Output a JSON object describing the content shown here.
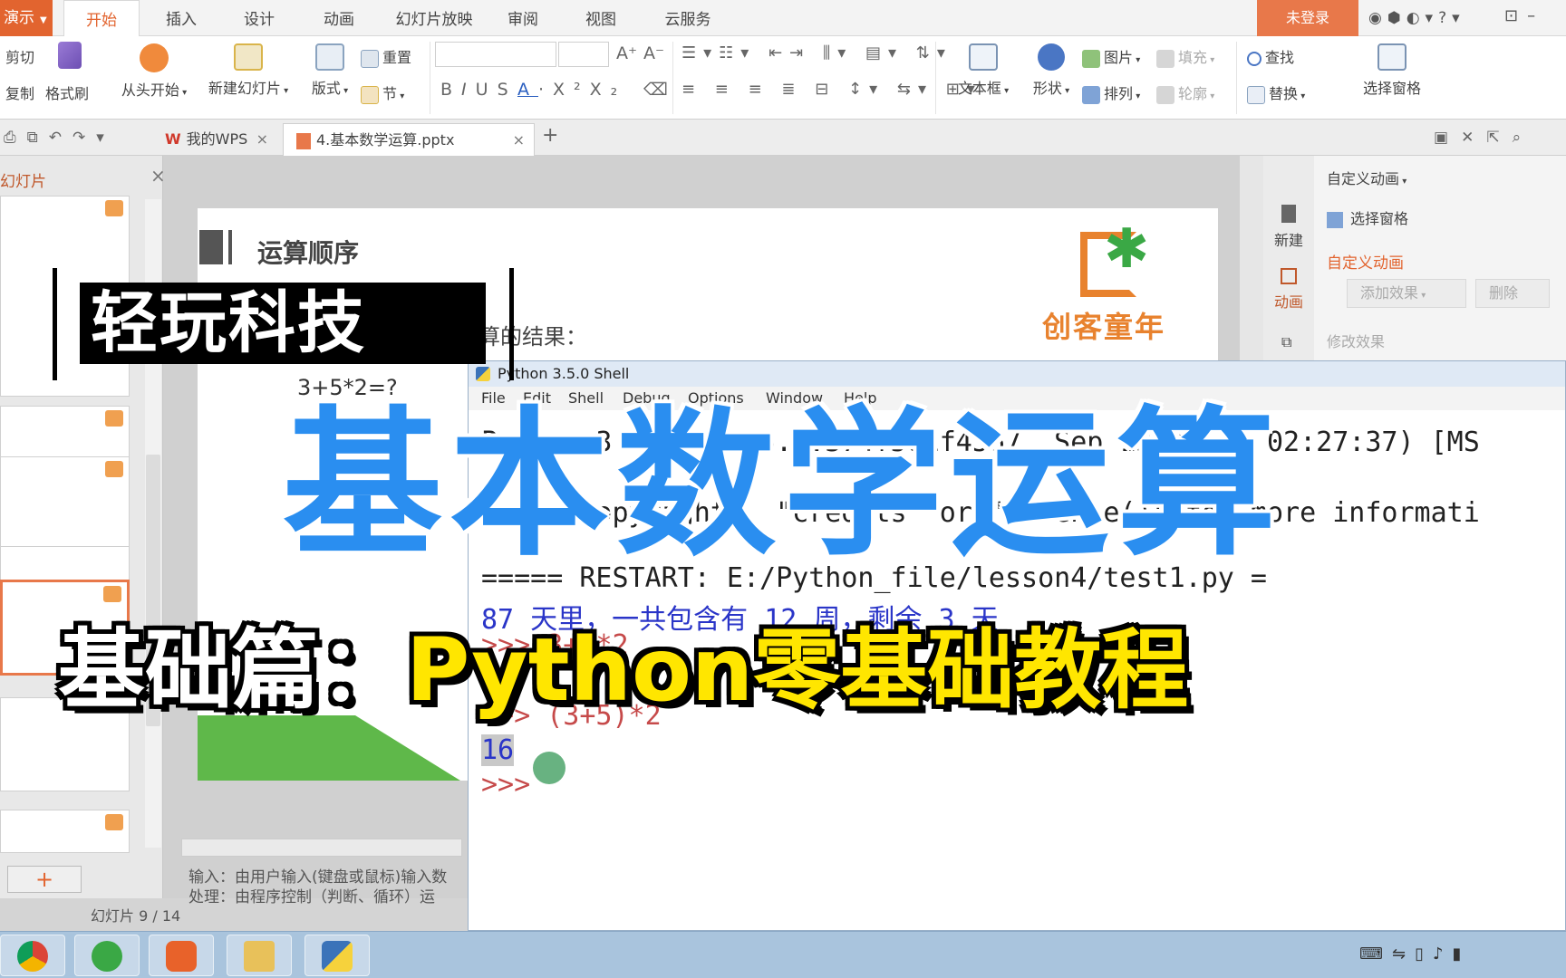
{
  "ribbon_tabs": {
    "app_button": "演示",
    "tabs": [
      "开始",
      "插入",
      "设计",
      "动画",
      "幻灯片放映",
      "审阅",
      "视图",
      "云服务"
    ],
    "active_tab": "开始",
    "login": "未登录"
  },
  "ribbon": {
    "cut": "剪切",
    "copy": "复制",
    "format_painter": "格式刷",
    "from_start": "从头开始",
    "new_slide": "新建幻灯片",
    "layout": "版式",
    "reset": "重置",
    "section": "节",
    "text_box": "文本框",
    "shape": "形状",
    "picture": "图片",
    "arrange": "排列",
    "fill": "填充",
    "outline": "轮廓",
    "find": "查找",
    "replace": "替换",
    "select_pane": "选择窗格"
  },
  "doc_tabs": {
    "my_wps": "我的WPS",
    "file": "4.基本数学运算.pptx",
    "add": "+"
  },
  "left_panel": {
    "title": "幻灯片",
    "status": "幻灯片 9 / 14",
    "add": "+"
  },
  "slide": {
    "title": "运算顺序",
    "subtitle": "算的结果：",
    "expression": "3+5*2=?",
    "logo_text": "创客童年",
    "notes_line1": "输入：由用户输入(键盘或鼠标)输入数",
    "notes_line2": "处理：由程序控制（判断、循环）运"
  },
  "right_pane": {
    "new": "新建",
    "animation": "动画",
    "custom_animation_dropdown": "自定义动画",
    "select_pane": "选择窗格",
    "custom_animation_title": "自定义动画",
    "add_effect": "添加效果",
    "delete": "删除",
    "modify_effect": "修改效果"
  },
  "python_shell": {
    "title": "Python 3.5.0 Shell",
    "menu": [
      "File",
      "Edit",
      "Shell",
      "Debug",
      "Options",
      "Window",
      "Help"
    ],
    "line1": "Python 3.5.0 (v3.5.0:374f501f4567, Sep 13 2015, 02:27:37) [MS",
    "line2": "Type \"copyright\", \"credits\" or \"license()\" for more informati",
    "line3": "===== RESTART: E:/Python_file/lesson4/test1.py =",
    "line4": "87 天里，一共包含有 12 周，剩余 3 天",
    "line5": ">>> 3+5*2",
    "line6": ">>> (3+5)*2",
    "result": "16",
    "prompt": ">>>"
  },
  "overlay": {
    "brand": "轻玩科技",
    "headline": "基本数学运算",
    "subtitle_prefix": "基础篇：",
    "subtitle_main": "Python零基础教程"
  },
  "colors": {
    "accent_orange": "#e2642f",
    "headline_blue": "#2a8ef0",
    "subtitle_yellow": "#ffe600",
    "shell_output_blue": "#2a35c8"
  }
}
